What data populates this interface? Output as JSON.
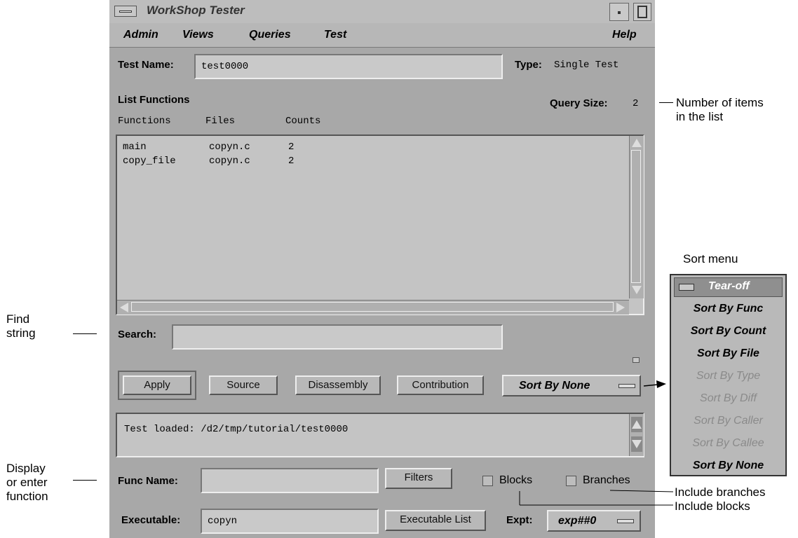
{
  "window": {
    "title": "WorkShop Tester",
    "menus": [
      "Admin",
      "Views",
      "Queries",
      "Test",
      "Help"
    ]
  },
  "test_name": {
    "label": "Test Name:",
    "value": "test0000"
  },
  "type": {
    "label": "Type:",
    "value": "Single Test"
  },
  "list": {
    "title": "List Functions",
    "query_size_label": "Query Size:",
    "query_size": "2",
    "columns": [
      "Functions",
      "Files",
      "Counts"
    ],
    "rows": [
      {
        "function": "main",
        "file": "copyn.c",
        "count": "2"
      },
      {
        "function": "copy_file",
        "file": "copyn.c",
        "count": "2"
      }
    ]
  },
  "search": {
    "label": "Search:",
    "value": ""
  },
  "buttons": {
    "apply": "Apply",
    "source": "Source",
    "disassembly": "Disassembly",
    "contribution": "Contribution",
    "sort": "Sort By None"
  },
  "status": {
    "message": "Test loaded: /d2/tmp/tutorial/test0000"
  },
  "func_name": {
    "label": "Func Name:",
    "value": "",
    "filters": "Filters",
    "blocks": "Blocks",
    "branches": "Branches"
  },
  "executable": {
    "label": "Executable:",
    "value": "copyn",
    "list_button": "Executable List",
    "expt_label": "Expt:",
    "expt_value": "exp##0"
  },
  "sort_menu": {
    "caption": "Sort menu",
    "tear_off": "Tear-off",
    "items": [
      {
        "label": "Sort By Func",
        "enabled": true
      },
      {
        "label": "Sort By Count",
        "enabled": true
      },
      {
        "label": "Sort By File",
        "enabled": true
      },
      {
        "label": "Sort By Type",
        "enabled": false
      },
      {
        "label": "Sort By Diff",
        "enabled": false
      },
      {
        "label": "Sort By Caller",
        "enabled": false
      },
      {
        "label": "Sort By Callee",
        "enabled": false
      },
      {
        "label": "Sort By None",
        "enabled": true
      }
    ]
  },
  "annotations": {
    "number_of_items": [
      "Number of items",
      "in the list"
    ],
    "find_string": [
      "Find",
      "string"
    ],
    "display_function": [
      "Display",
      "or enter",
      "function"
    ],
    "include_branches": "Include branches",
    "include_blocks": "Include blocks"
  }
}
